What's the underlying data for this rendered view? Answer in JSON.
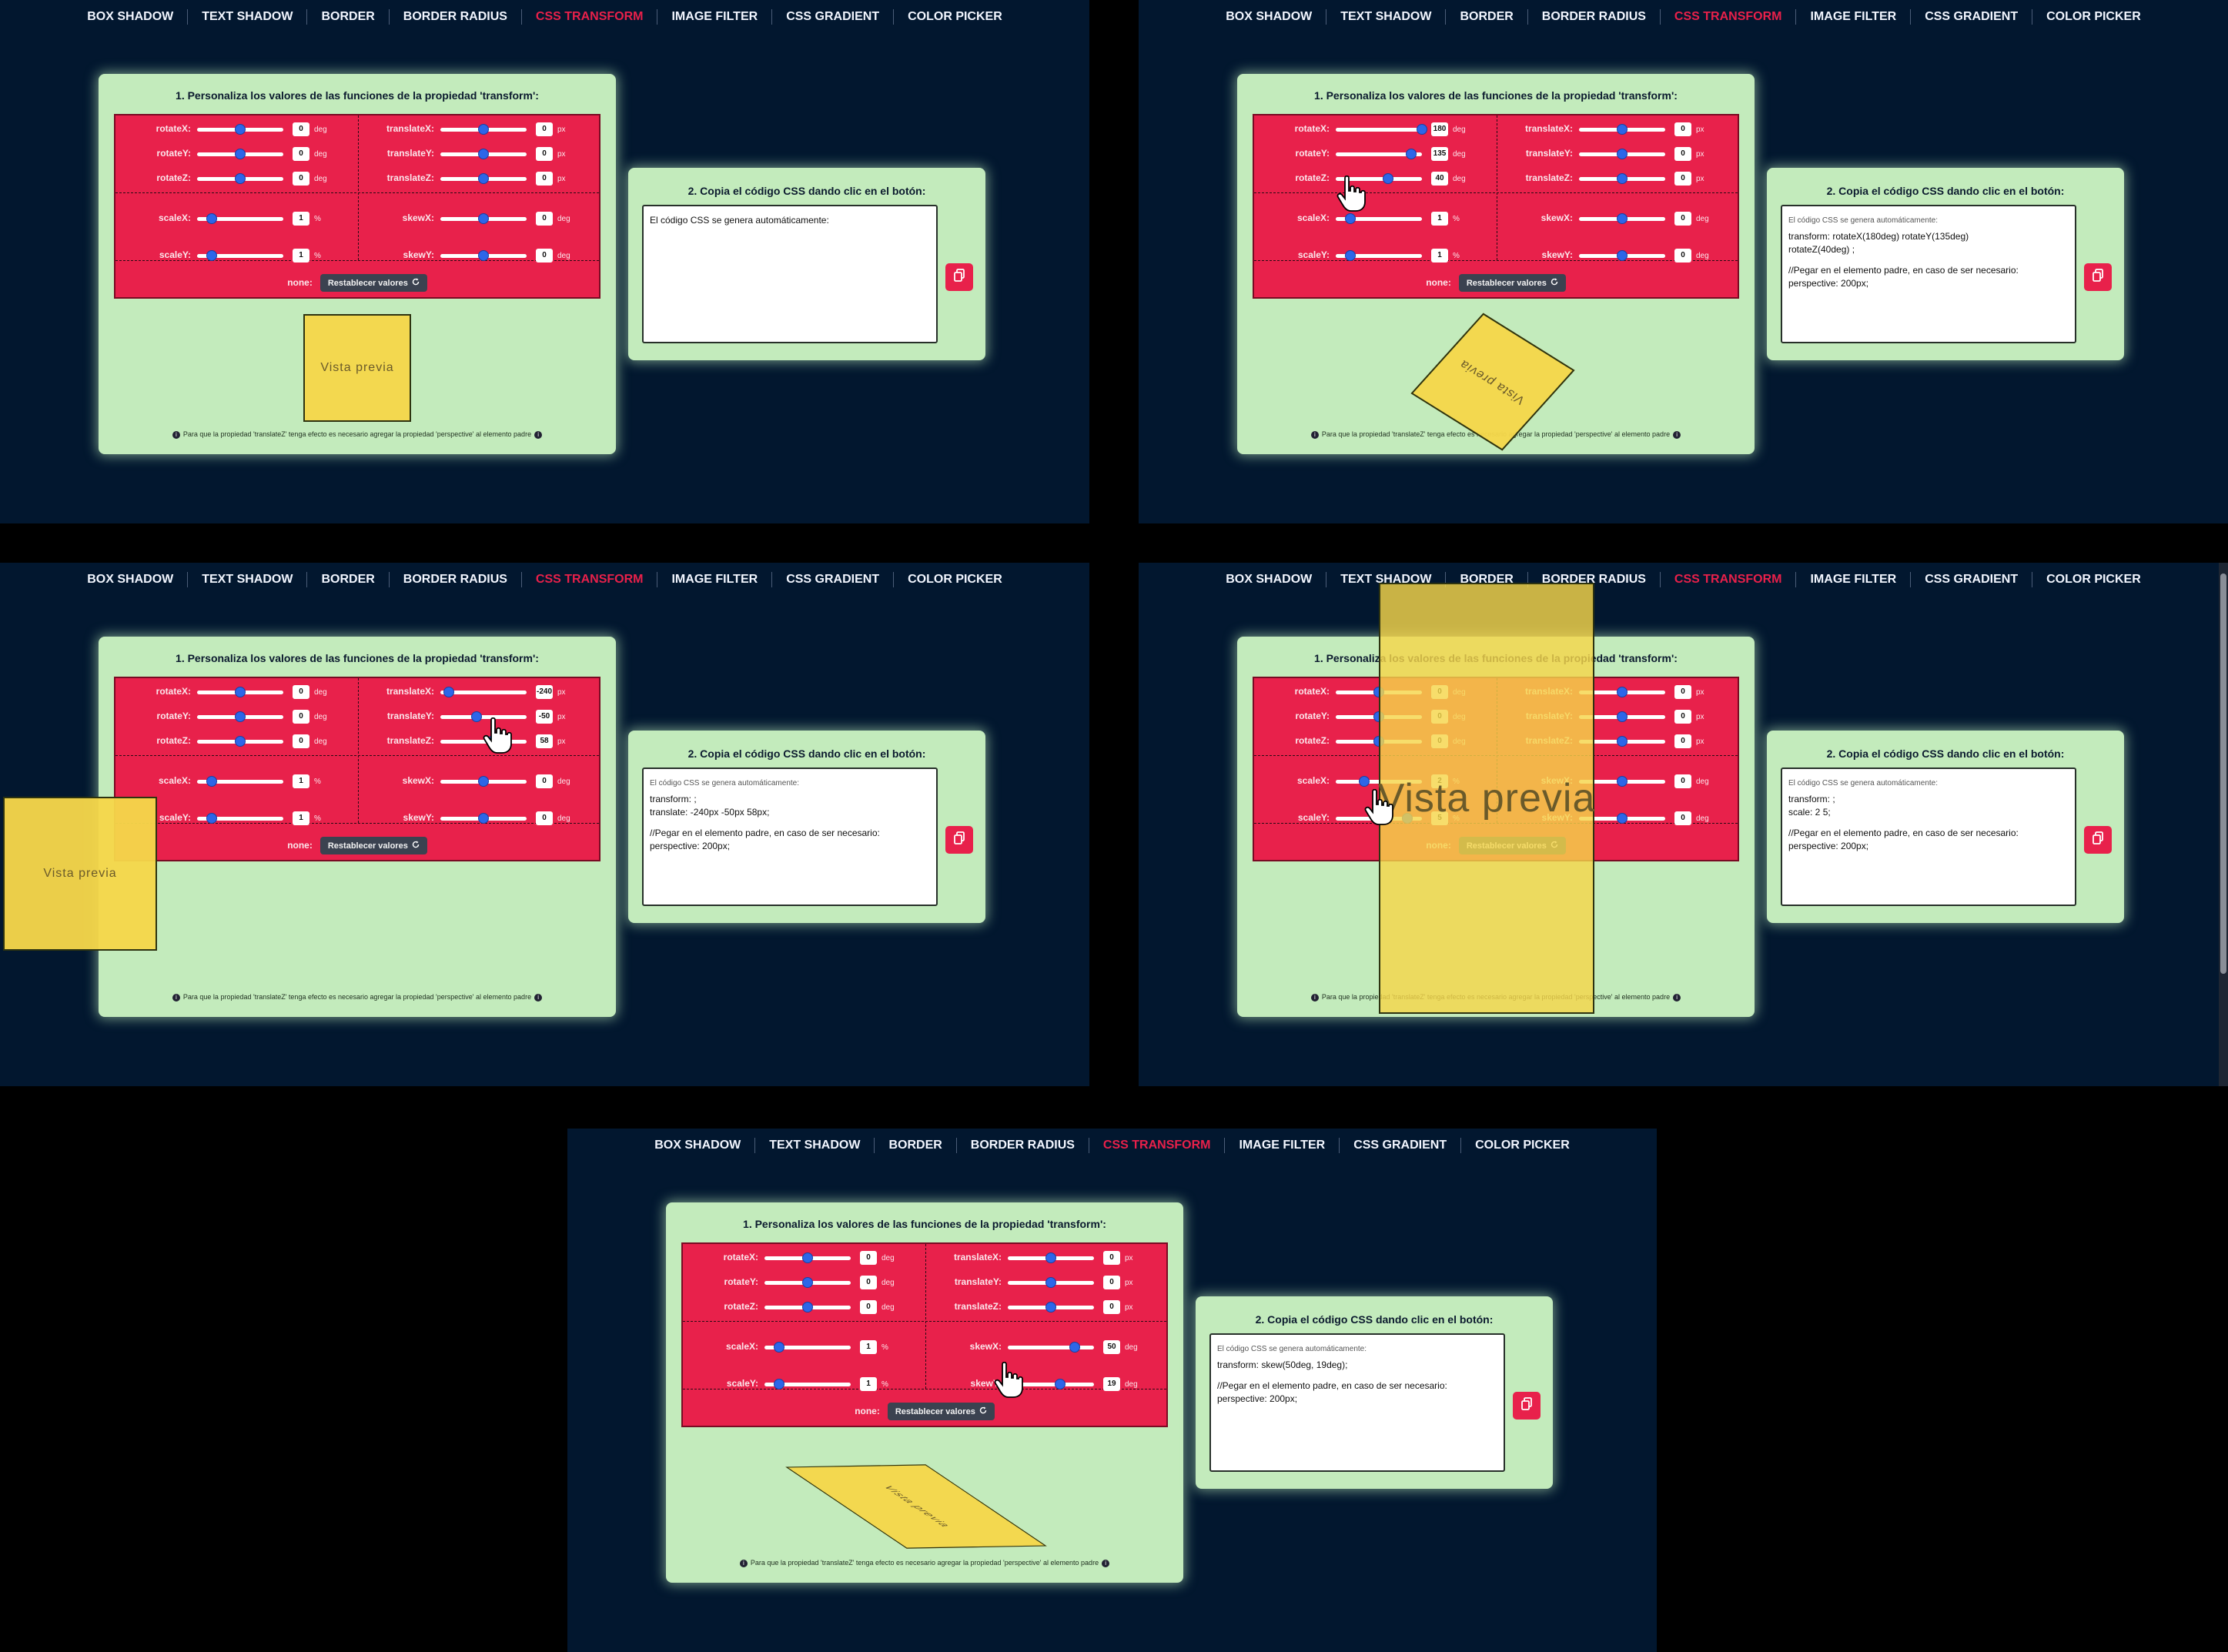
{
  "colors": {
    "page_bg": "#02172f",
    "accent": "#e8204a",
    "card_bg": "#c3ebbc",
    "control_bg": "#e8214b",
    "preview_bg": "#f5d64a"
  },
  "nav": [
    "BOX SHADOW",
    "TEXT SHADOW",
    "BORDER",
    "BORDER RADIUS",
    "CSS TRANSFORM",
    "IMAGE FILTER",
    "CSS GRADIENT",
    "COLOR PICKER"
  ],
  "nav_active": "CSS TRANSFORM",
  "card_a_title": "1. Personaliza los valores de las funciones de la propiedad 'transform':",
  "card_b_title": "2. Copia el código CSS dando clic en el botón:",
  "none_label": "none:",
  "reset_label": "Restablecer valores",
  "preview_label": "Vista previa",
  "footnote": "Para que la propiedad 'translateZ' tenga efecto es necesario agregar la propiedad 'perspective' al elemento padre",
  "code_placeholder": "El código CSS se genera automáticamente:",
  "labels": {
    "rotateX": "rotateX:",
    "rotateY": "rotateY:",
    "rotateZ": "rotateZ:",
    "translateX": "translateX:",
    "translateY": "translateY:",
    "translateZ": "translateZ:",
    "scaleX": "scaleX:",
    "scaleY": "scaleY:",
    "skewX": "skewX:",
    "skewY": "skewY:"
  },
  "units": {
    "deg": "deg",
    "px": "px",
    "pct": "%"
  },
  "panels": [
    {
      "values": {
        "rotateX": "0",
        "rotateY": "0",
        "rotateZ": "0",
        "translateX": "0",
        "translateY": "0",
        "translateZ": "0",
        "scaleX": "1",
        "scaleY": "1",
        "skewX": "0",
        "skewY": "0"
      },
      "code_lines": [
        "El código CSS se genera automáticamente:"
      ]
    },
    {
      "values": {
        "rotateX": "180",
        "rotateY": "135",
        "rotateZ": "40",
        "translateX": "0",
        "translateY": "0",
        "translateZ": "0",
        "scaleX": "1",
        "scaleY": "1",
        "skewX": "0",
        "skewY": "0"
      },
      "code_lines": [
        "transform: rotateX(180deg) rotateY(135deg)",
        "rotateZ(40deg) ;",
        "",
        "//Pegar en el elemento padre, en caso de ser necesario:",
        "perspective: 200px;"
      ]
    },
    {
      "values": {
        "rotateX": "0",
        "rotateY": "0",
        "rotateZ": "0",
        "translateX": "-240",
        "translateY": "-50",
        "translateZ": "58",
        "scaleX": "1",
        "scaleY": "1",
        "skewX": "0",
        "skewY": "0"
      },
      "code_lines": [
        "transform: ;",
        "translate: -240px -50px 58px;",
        "",
        "//Pegar en el elemento padre, en caso de ser necesario:",
        "perspective: 200px;"
      ]
    },
    {
      "values": {
        "rotateX": "0",
        "rotateY": "0",
        "rotateZ": "0",
        "translateX": "0",
        "translateY": "0",
        "translateZ": "0",
        "scaleX": "2",
        "scaleY": "5",
        "skewX": "0",
        "skewY": "0"
      },
      "code_lines": [
        "transform: ;",
        "scale: 2 5;",
        "",
        "//Pegar en el elemento padre, en caso de ser necesario:",
        "perspective: 200px;"
      ]
    },
    {
      "values": {
        "rotateX": "0",
        "rotateY": "0",
        "rotateZ": "0",
        "translateX": "0",
        "translateY": "0",
        "translateZ": "0",
        "scaleX": "1",
        "scaleY": "1",
        "skewX": "50",
        "skewY": "19"
      },
      "code_lines": [
        "transform: skew(50deg, 19deg);",
        "",
        "//Pegar en el elemento padre, en caso de ser necesario:",
        "perspective: 200px;"
      ]
    }
  ]
}
